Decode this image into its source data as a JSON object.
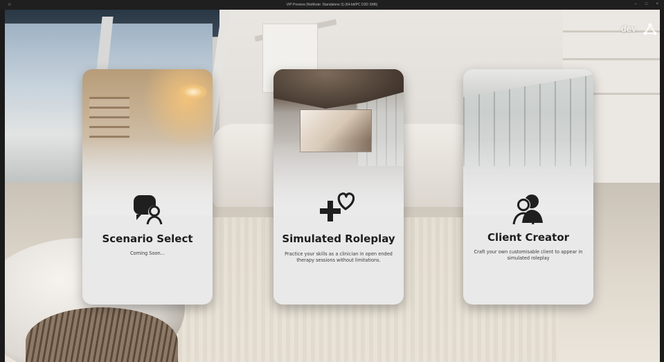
{
  "window": {
    "title": "VIP Preview (NoMode: Standalone 3) (64-bit/PC D3D SM6)",
    "controls": [
      "–",
      "□",
      "×"
    ]
  },
  "header": {
    "env_label": "dev",
    "brand_icon": "triangle-nodes-icon"
  },
  "cards": [
    {
      "title": "Scenario Select",
      "description": "Coming Soon...",
      "icon": "chat-person-icon"
    },
    {
      "title": "Simulated Roleplay",
      "description": "Practice your skills as a clinician in open ended therapy sessions without limitations.",
      "icon": "plus-heart-icon"
    },
    {
      "title": "Client Creator",
      "description": "Craft your own customisable client to appear in simulated roleplay",
      "icon": "two-people-icon"
    }
  ],
  "colors": {
    "title_text": "#1e1e1e",
    "icon_fill": "#1f1f1f",
    "card_body": "#e9e9e9"
  }
}
